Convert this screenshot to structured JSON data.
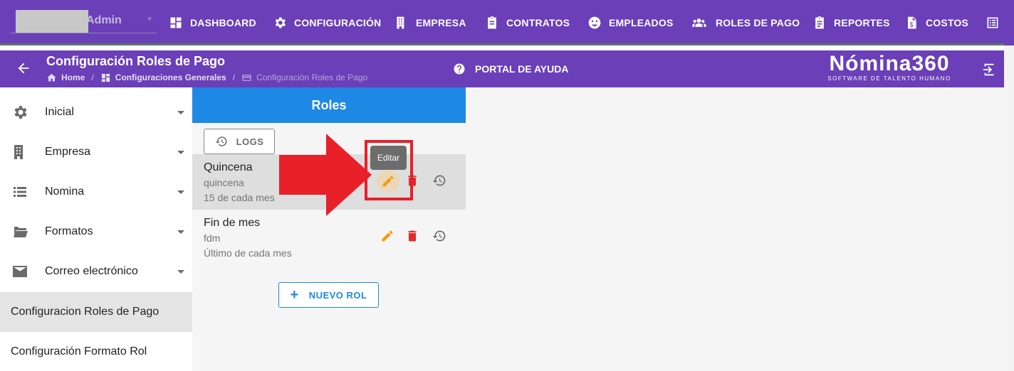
{
  "topbar": {
    "user_name": "Admin",
    "nav": [
      {
        "label": "DASHBOARD",
        "icon": "dashboard-icon"
      },
      {
        "label": "CONFIGURACIÓN",
        "icon": "gear-icon"
      },
      {
        "label": "EMPRESA",
        "icon": "building-icon"
      },
      {
        "label": "CONTRATOS",
        "icon": "clipboard-icon"
      },
      {
        "label": "EMPLEADOS",
        "icon": "face-icon"
      },
      {
        "label": "ROLES DE PAGO",
        "icon": "group-icon"
      },
      {
        "label": "REPORTES",
        "icon": "report-icon"
      },
      {
        "label": "COSTOS",
        "icon": "invoice-icon"
      },
      {
        "label": "",
        "icon": "list-alt-icon"
      }
    ]
  },
  "subheader": {
    "title": "Configuración Roles de Pago",
    "breadcrumb": {
      "home": "Home",
      "general": "Configuraciones Generales",
      "current": "Configuración Roles de Pago"
    },
    "help_label": "PORTAL DE AYUDA",
    "brand_name": "Nómina360",
    "brand_tagline": "SOFTWARE DE TALENTO HUMANO"
  },
  "sidebar": {
    "items": [
      {
        "label": "Inicial",
        "icon": "gear-icon"
      },
      {
        "label": "Empresa",
        "icon": "building-icon"
      },
      {
        "label": "Nomina",
        "icon": "list-icon"
      },
      {
        "label": "Formatos",
        "icon": "folder-open-icon"
      },
      {
        "label": "Correo electrónico",
        "icon": "mail-icon"
      }
    ],
    "links": [
      {
        "label": "Configuracion Roles de Pago",
        "active": true
      },
      {
        "label": "Configuración Formato Rol",
        "active": false
      }
    ]
  },
  "roles": {
    "header": "Roles",
    "logs_label": "LOGS",
    "items": [
      {
        "name": "Quincena",
        "code": "quincena",
        "description": "15 de cada mes"
      },
      {
        "name": "Fin de mes",
        "code": "fdm",
        "description": "Último de cada mes"
      }
    ],
    "new_role_label": "NUEVO ROL",
    "tooltip": "Editar"
  },
  "colors": {
    "brand_purple": "#6a3fb8",
    "roles_header_blue": "#1e88e5",
    "edit_orange": "#f59a10",
    "delete_red": "#e02b2b",
    "annotation_red": "#e8202a"
  }
}
